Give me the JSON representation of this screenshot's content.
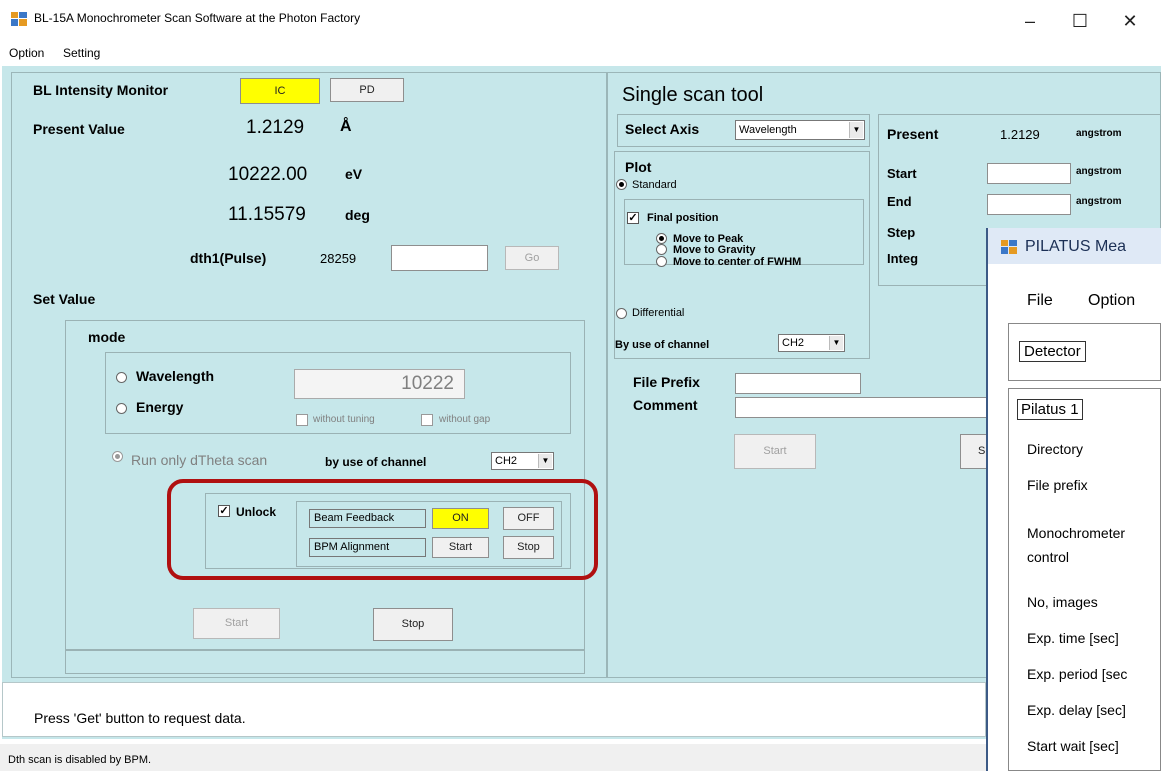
{
  "window": {
    "title": "BL-15A Monochrometer Scan Software at the Photon Factory",
    "minimize": "–",
    "maximize": "☐",
    "close": "✕"
  },
  "menu": {
    "option": "Option",
    "setting": "Setting"
  },
  "left": {
    "monitor_label": "BL Intensity Monitor",
    "ic_button": "IC",
    "pd_button": "PD",
    "present_label": "Present Value",
    "present_angstrom": "1.2129",
    "unit_angstrom": "Å",
    "present_ev": "10222.00",
    "unit_ev": "eV",
    "present_deg": "11.15579",
    "unit_deg": "deg",
    "dth1_label": "dth1(Pulse)",
    "dth1_value": "28259",
    "go_button": "Go",
    "set_value_label": "Set Value",
    "mode_label": "mode",
    "wavelength_label": "Wavelength",
    "energy_label": "Energy",
    "mode_input_value": "10222",
    "without_tuning": "without tuning",
    "without_gap": "without gap",
    "run_dtheta": "Run only dTheta scan",
    "by_use_channel": "by use of channel",
    "channel_value": "CH2",
    "unlock_label": "Unlock",
    "unlock_check": "✓",
    "beam_feedback_label": "Beam Feedback",
    "on_button": "ON",
    "off_button": "OFF",
    "bpm_alignment_label": "BPM Alignment",
    "bpm_start": "Start",
    "bpm_stop": "Stop",
    "start_button": "Start",
    "stop_button": "Stop"
  },
  "scan": {
    "title": "Single scan tool",
    "select_axis_label": "Select Axis",
    "axis_value": "Wavelength",
    "plot_label": "Plot",
    "standard_label": "Standard",
    "final_position_label": "Final position",
    "final_check": "✓",
    "move_peak": "Move to Peak",
    "move_gravity": "Move to Gravity",
    "move_fwhm": "Move to center of FWHM",
    "differential_label": "Differential",
    "by_use_channel": "By use of channel",
    "channel_value": "CH2",
    "file_prefix_label": "File Prefix",
    "comment_label": "Comment",
    "start_button": "Start",
    "s_button": "S",
    "present_label": "Present",
    "present_value": "1.2129",
    "present_unit": "angstrom",
    "start_label": "Start",
    "start_unit": "angstrom",
    "end_label": "End",
    "end_unit": "angstrom",
    "step_label": "Step",
    "integ_label": "Integ"
  },
  "pilatus": {
    "title": "PILATUS Mea",
    "menu_file": "File",
    "menu_option": "Option",
    "detector_label": "Detector",
    "pilatus1": "Pilatus 1",
    "directory": "Directory",
    "file_prefix": "File prefix",
    "mono_line1": "Monochrometer",
    "mono_line2": "control",
    "no_images": "No, images",
    "exp_time": "Exp. time [sec]",
    "exp_period": "Exp. period [sec",
    "exp_delay": "Exp. delay [sec]",
    "start_wait": "Start wait [sec]"
  },
  "message": "Press 'Get' button to request data.",
  "status_bar": "Dth scan is disabled by BPM.",
  "colors": {
    "panel": "#c6e7ea",
    "highlight": "#ffff00",
    "annotation": "#b01010"
  }
}
